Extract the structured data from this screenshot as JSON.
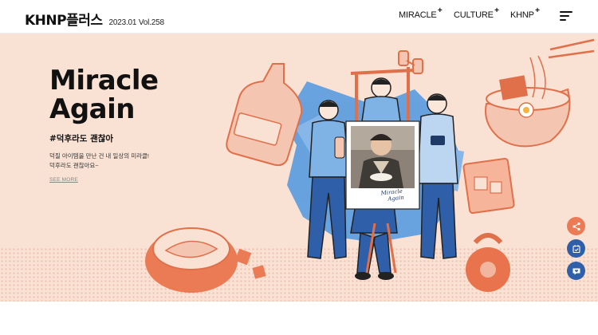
{
  "header": {
    "logo": "KHNP플러스",
    "issue": "2023.01 Vol.258",
    "nav": [
      {
        "label": "MIRACLE",
        "plus": "+"
      },
      {
        "label": "CULTURE",
        "plus": "+"
      },
      {
        "label": "KHNP",
        "plus": "+"
      }
    ],
    "menu_icon": "hamburger-menu-icon"
  },
  "hero": {
    "title_line1": "Miracle",
    "title_line2": "Again",
    "hashtag": "#덕후라도 괜찮아",
    "desc_line1": "덕질 아이템을 만난 건 내 일상의 미라클!",
    "desc_line2": "덕후라도 괜찮아요~",
    "see_more": "SEE MORE",
    "polaroid_caption_1": "Miracle",
    "polaroid_caption_2": "Again",
    "colors": {
      "background": "#f9e1d4",
      "accent_orange": "#ec7a54",
      "accent_blue": "#2f5fa8"
    }
  },
  "floating": {
    "share_icon": "share-icon",
    "calendar_icon": "calendar-check-icon",
    "subscribe_icon": "heart-chat-icon",
    "colors": [
      "#ec7a54",
      "#2f5fa8",
      "#2f5fa8"
    ]
  }
}
